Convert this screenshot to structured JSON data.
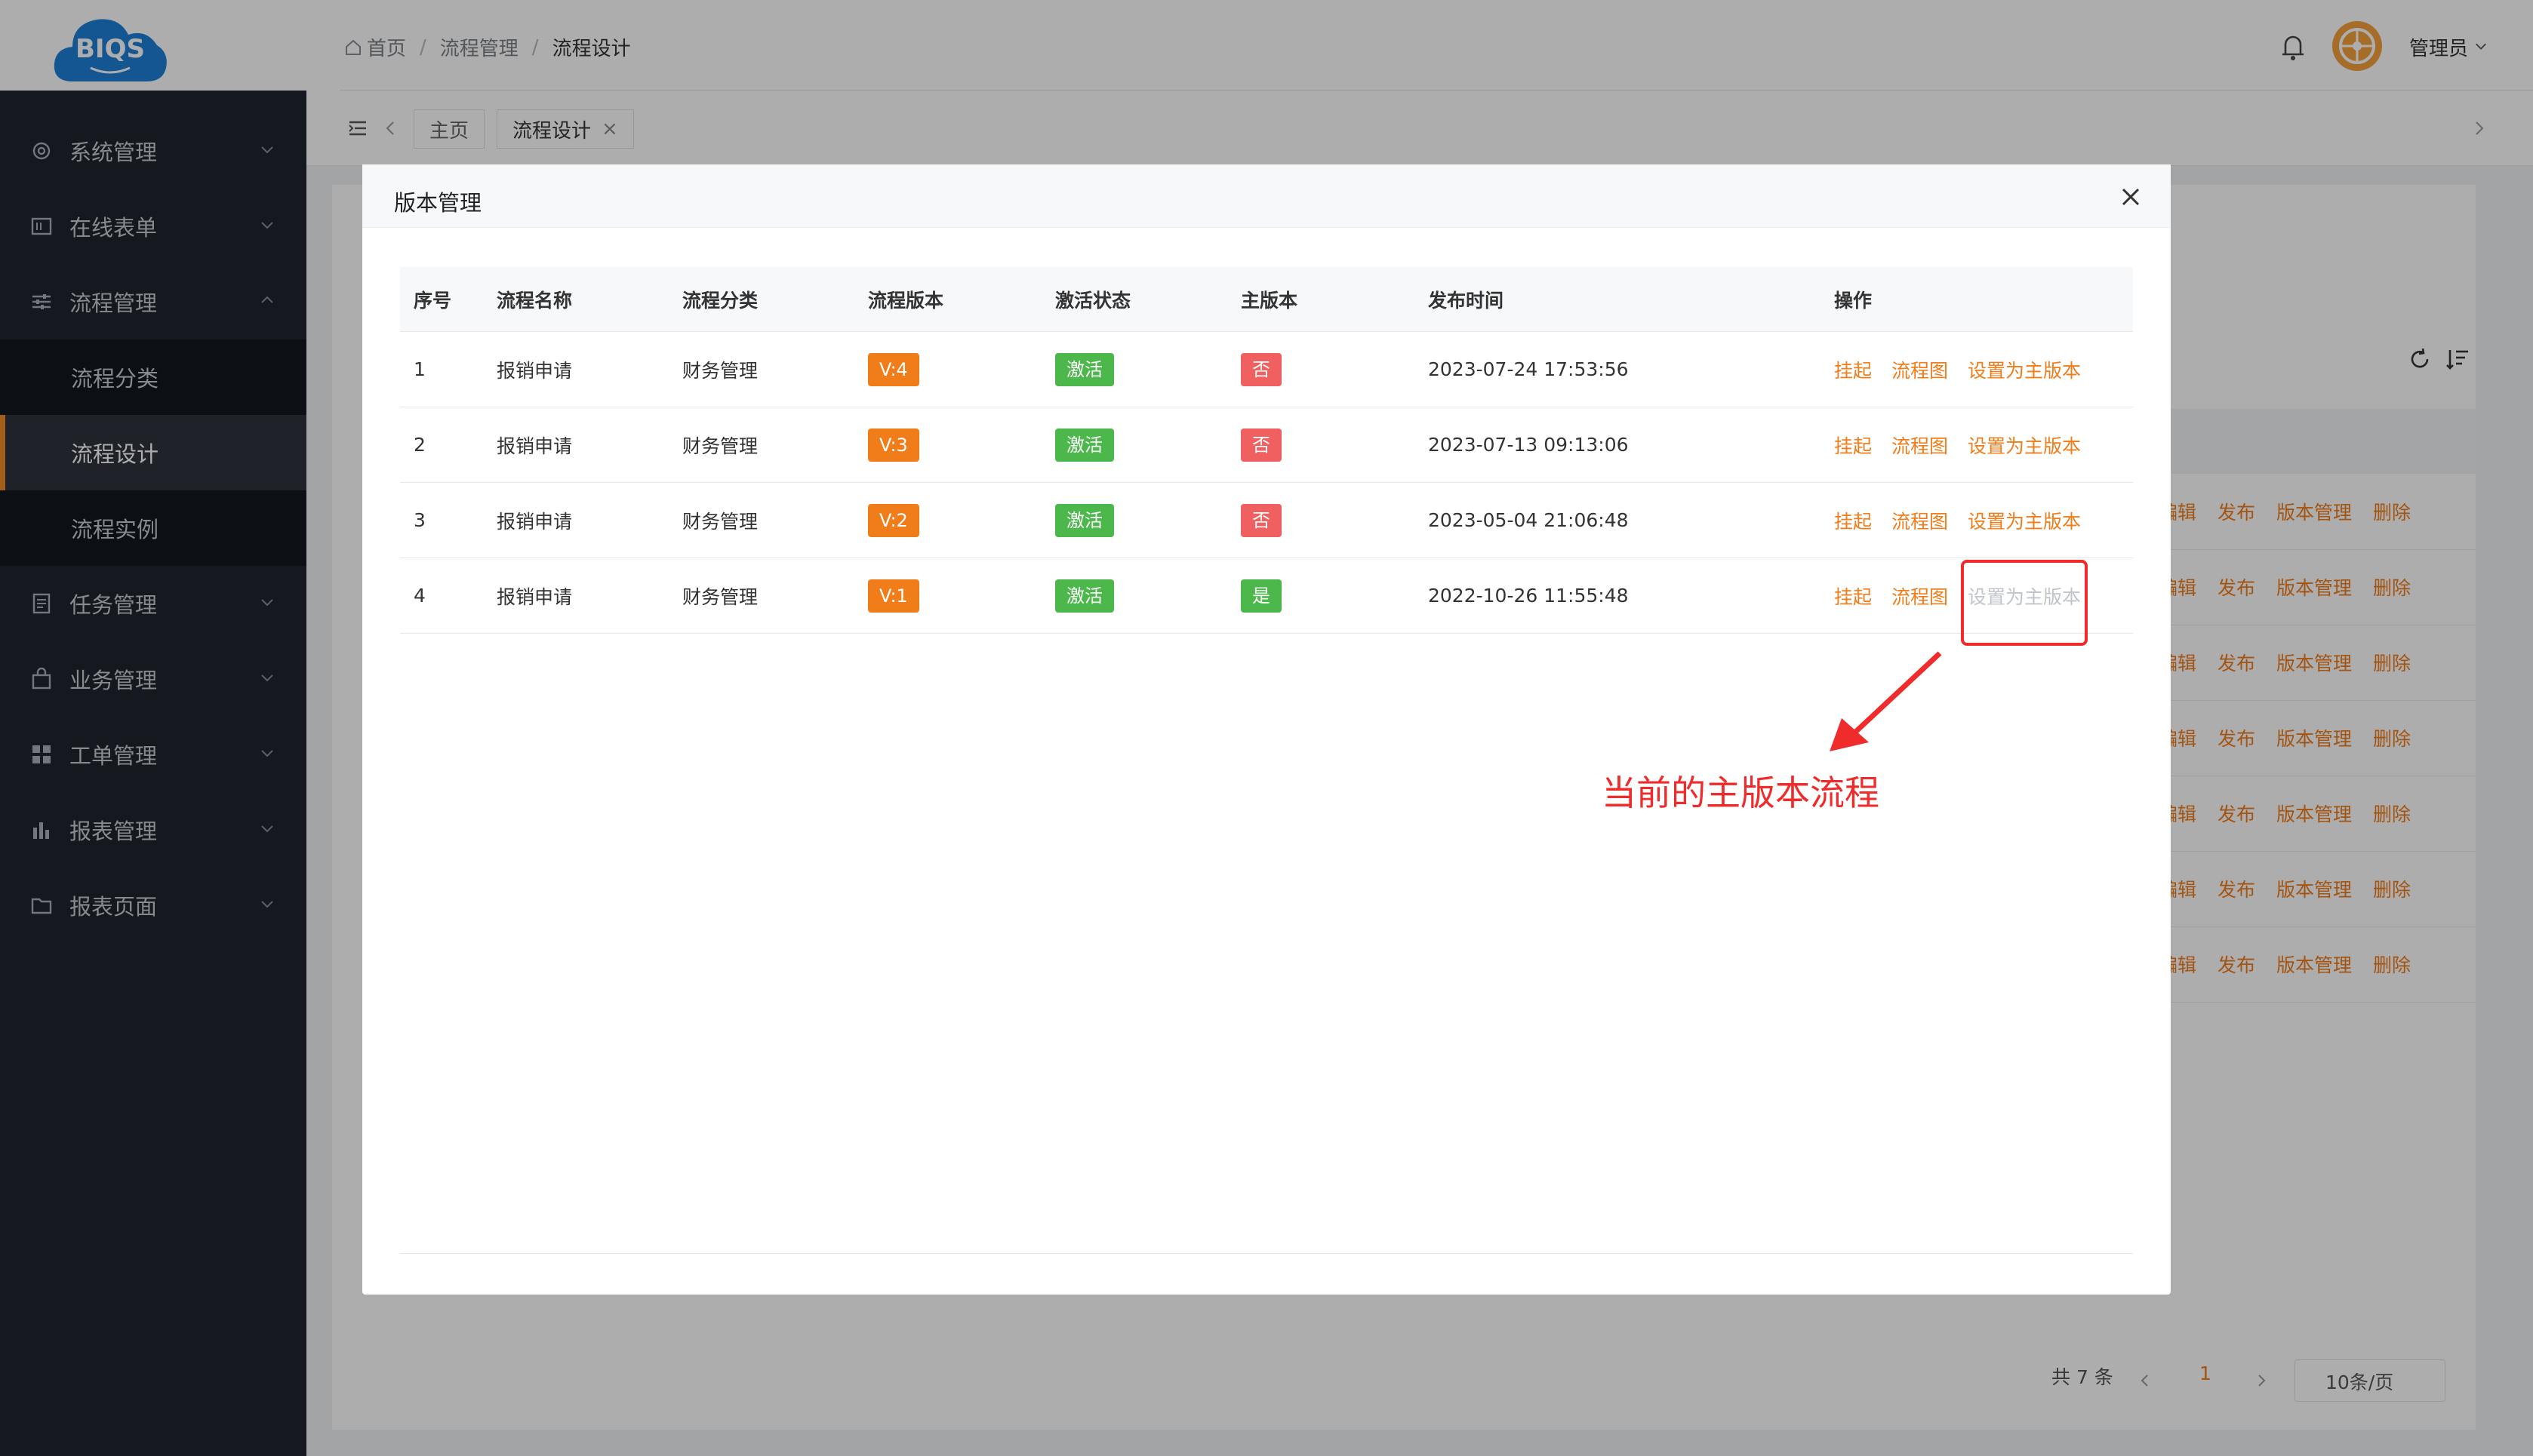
{
  "logo": {
    "text": "BIQS"
  },
  "sidebar": {
    "items": [
      {
        "label": "系统管理",
        "icon": "gear-icon"
      },
      {
        "label": "在线表单",
        "icon": "form-icon"
      },
      {
        "label": "流程管理",
        "icon": "sliders-icon",
        "expanded": true,
        "children": [
          {
            "label": "流程分类"
          },
          {
            "label": "流程设计",
            "active": true
          },
          {
            "label": "流程实例"
          }
        ]
      },
      {
        "label": "任务管理",
        "icon": "document-icon"
      },
      {
        "label": "业务管理",
        "icon": "bag-icon"
      },
      {
        "label": "工单管理",
        "icon": "grid-icon"
      },
      {
        "label": "报表管理",
        "icon": "bar-chart-icon"
      },
      {
        "label": "报表页面",
        "icon": "folder-icon"
      }
    ]
  },
  "header": {
    "breadcrumb": [
      "首页",
      "流程管理",
      "流程设计"
    ],
    "separator": "/",
    "user_name": "管理员"
  },
  "tabs": [
    {
      "label": "主页"
    },
    {
      "label": "流程设计",
      "closable": true,
      "close_glyph": "×"
    }
  ],
  "background": {
    "row_actions": [
      "编辑",
      "发布",
      "版本管理",
      "删除"
    ],
    "row_count": 7,
    "pagination": {
      "total": "共 7 条",
      "current_page": "1",
      "page_size": "10条/页"
    }
  },
  "modal": {
    "title": "版本管理",
    "columns": [
      "序号",
      "流程名称",
      "流程分类",
      "流程版本",
      "激活状态",
      "主版本",
      "发布时间",
      "操作"
    ],
    "rows": [
      {
        "index": "1",
        "name": "报销申请",
        "category": "财务管理",
        "version": "V:4",
        "status": "激活",
        "main": "否",
        "time": "2023-07-24 17:53:56",
        "ops": [
          "挂起",
          "流程图",
          "设置为主版本"
        ]
      },
      {
        "index": "2",
        "name": "报销申请",
        "category": "财务管理",
        "version": "V:3",
        "status": "激活",
        "main": "否",
        "time": "2023-07-13 09:13:06",
        "ops": [
          "挂起",
          "流程图",
          "设置为主版本"
        ]
      },
      {
        "index": "3",
        "name": "报销申请",
        "category": "财务管理",
        "version": "V:2",
        "status": "激活",
        "main": "否",
        "time": "2023-05-04 21:06:48",
        "ops": [
          "挂起",
          "流程图",
          "设置为主版本"
        ]
      },
      {
        "index": "4",
        "name": "报销申请",
        "category": "财务管理",
        "version": "V:1",
        "status": "激活",
        "main": "是",
        "time": "2022-10-26 11:55:48",
        "ops": [
          "挂起",
          "流程图",
          "设置为主版本"
        ],
        "set_main_disabled": true
      }
    ]
  },
  "annotation": {
    "text": "当前的主版本流程",
    "color": "#ef2b2b"
  },
  "colors": {
    "accent": "#f07c1a",
    "success": "#4cb84c",
    "danger": "#f06060",
    "sidebar": "#20262f"
  }
}
